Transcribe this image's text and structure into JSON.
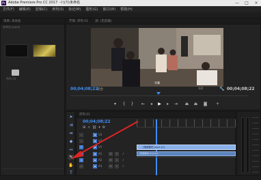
{
  "window": {
    "icon_label": "Pr",
    "title": "Adobe Premiere Pro CC 2017 - I:\\(?)\\未命名",
    "minimize": "—",
    "maximize": "□",
    "close": "×"
  },
  "menu": [
    "文件(F)",
    "编辑(E)",
    "剪辑(C)",
    "序列(S)",
    "标记(M)",
    "图形(G)",
    "窗口(W)",
    "帮助(H)"
  ],
  "project_panel": {
    "tab": "项目: 未命名",
    "sub": "未命名.prproj",
    "items": [
      {
        "caption": ""
      },
      {
        "caption": ""
      },
      {
        "caption": "序列 01"
      }
    ]
  },
  "program_panel": {
    "tabs": [
      "节目: 序列 01",
      "源: (无剪辑)"
    ],
    "timecode_left": "00;04;08;22",
    "fit_label": "适合",
    "quality": "1/2",
    "timecode_right": "00;04;08;22",
    "subtitle": "字幕"
  },
  "timeline_panel": {
    "tab": "序列 01",
    "timecode": "00;04;08;22",
    "tracks": [
      {
        "name": "V3",
        "type": "video"
      },
      {
        "name": "V2",
        "type": "video"
      },
      {
        "name": "V1",
        "type": "video"
      },
      {
        "name": "A1",
        "type": "audio"
      },
      {
        "name": "A2",
        "type": "audio"
      },
      {
        "name": "A3",
        "type": "audio"
      }
    ],
    "video_clip": "[视频素材].mp4 [V]",
    "audio_clip": "[音频素材].mp4 [A]"
  },
  "tools": [
    "select-tool",
    "track-select-tool",
    "ripple-edit-tool",
    "razor-tool",
    "slip-tool",
    "pen-tool",
    "hand-tool",
    "type-tool"
  ],
  "colors": {
    "accent": "#3f8ef5",
    "annotation_arrow": "#e02424",
    "clip_video": "#8ab0ea",
    "clip_audio": "#5c84bd"
  }
}
